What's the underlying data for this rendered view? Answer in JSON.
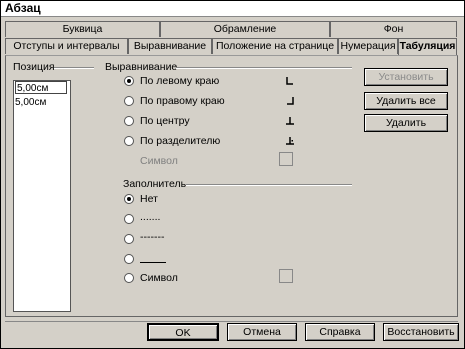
{
  "window": {
    "title": "Абзац"
  },
  "tabs_back": [
    {
      "label": "Буквица"
    },
    {
      "label": "Обрамление"
    },
    {
      "label": "Фон"
    }
  ],
  "tabs_front": [
    {
      "label": "Отступы и интервалы"
    },
    {
      "label": "Выравнивание"
    },
    {
      "label": "Положение на странице"
    },
    {
      "label": "Нумерация"
    },
    {
      "label": "Табуляция",
      "active": true
    }
  ],
  "position": {
    "label": "Позиция",
    "input_value": "5,00см",
    "items": [
      "5,00см"
    ]
  },
  "alignment": {
    "label": "Выравнивание",
    "options": [
      {
        "label": "По левому краю",
        "checked": true,
        "icon": "tab-left-icon"
      },
      {
        "label": "По правому краю",
        "checked": false,
        "icon": "tab-right-icon"
      },
      {
        "label": "По центру",
        "checked": false,
        "icon": "tab-center-icon"
      },
      {
        "label": "По разделителю",
        "checked": false,
        "icon": "tab-decimal-icon"
      }
    ],
    "symbol_label": "Символ"
  },
  "fill": {
    "label": "Заполнитель",
    "options": [
      {
        "label": "Нет",
        "checked": true
      },
      {
        "label": ".......",
        "checked": false
      },
      {
        "label": "-------",
        "checked": false
      },
      {
        "label": "",
        "checked": false
      },
      {
        "label": "Символ",
        "checked": false
      }
    ]
  },
  "side_buttons": {
    "new": "Установить",
    "clear_all": "Удалить все",
    "delete": "Удалить"
  },
  "footer_buttons": {
    "ok": "OK",
    "cancel": "Отмена",
    "help": "Справка",
    "reset": "Восстановить"
  }
}
